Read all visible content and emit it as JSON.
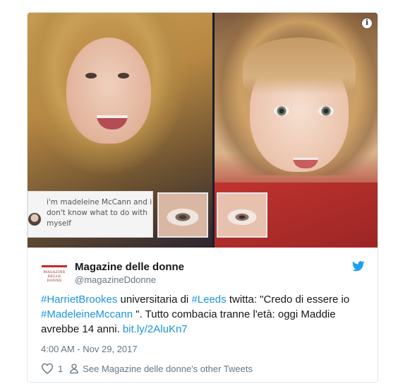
{
  "media": {
    "caption_text": "i'm madeleine McCann and i don't know what to do with myself"
  },
  "tweet": {
    "logo_text": "MAGAZINE DELLE DONNE",
    "display_name": "Magazine delle donne",
    "handle": "@magazineDdonne",
    "body": {
      "hashtag1": "#HarrietBrookes",
      "text1": " universitaria di ",
      "hashtag2": "#Leeds",
      "text2": " twitta: \"Credo di essere io ",
      "hashtag3": "#MadeleineMccann",
      "text3": " \". Tutto combacia tranne l'età: oggi Maddie avrebbe 14 anni. ",
      "link": "bit.ly/2AluKn7"
    },
    "timestamp": "4:00 AM - Nov 29, 2017",
    "like_count": "1",
    "see_more": "See Magazine delle donne's other Tweets"
  },
  "colors": {
    "link": "#1b95e0",
    "twitter_blue": "#1da1f2",
    "muted": "#657786"
  },
  "icons": [
    "info-icon",
    "twitter-bird-icon",
    "heart-icon",
    "person-icon"
  ]
}
